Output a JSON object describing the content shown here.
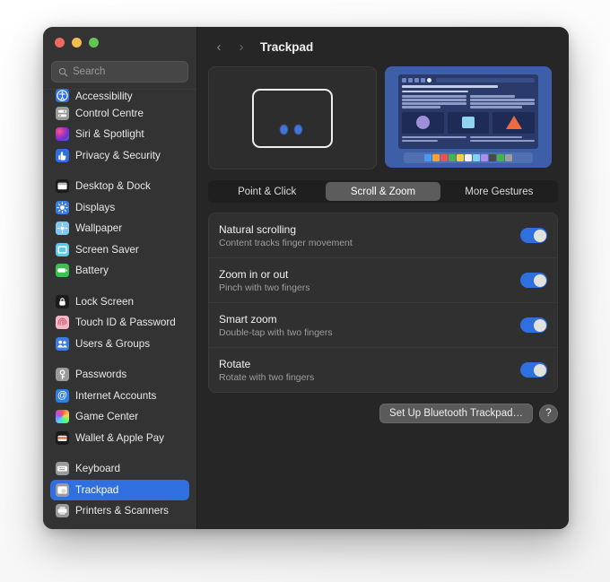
{
  "window": {
    "traffic_lights": [
      "close",
      "minimize",
      "zoom"
    ]
  },
  "sidebar": {
    "search": {
      "placeholder": "Search",
      "value": ""
    },
    "groups": [
      {
        "items": [
          {
            "label": "Accessibility",
            "icon": "accessibility-icon",
            "clipped": true
          },
          {
            "label": "Control Centre",
            "icon": "control-centre-icon"
          },
          {
            "label": "Siri & Spotlight",
            "icon": "siri-icon"
          },
          {
            "label": "Privacy & Security",
            "icon": "privacy-icon"
          }
        ]
      },
      {
        "items": [
          {
            "label": "Desktop & Dock",
            "icon": "desktop-dock-icon"
          },
          {
            "label": "Displays",
            "icon": "displays-icon"
          },
          {
            "label": "Wallpaper",
            "icon": "wallpaper-icon"
          },
          {
            "label": "Screen Saver",
            "icon": "screen-saver-icon"
          },
          {
            "label": "Battery",
            "icon": "battery-icon"
          }
        ]
      },
      {
        "items": [
          {
            "label": "Lock Screen",
            "icon": "lock-screen-icon"
          },
          {
            "label": "Touch ID & Password",
            "icon": "touch-id-icon"
          },
          {
            "label": "Users & Groups",
            "icon": "users-groups-icon"
          }
        ]
      },
      {
        "items": [
          {
            "label": "Passwords",
            "icon": "passwords-icon"
          },
          {
            "label": "Internet Accounts",
            "icon": "internet-accounts-icon"
          },
          {
            "label": "Game Center",
            "icon": "game-center-icon"
          },
          {
            "label": "Wallet & Apple Pay",
            "icon": "wallet-icon"
          }
        ]
      },
      {
        "items": [
          {
            "label": "Keyboard",
            "icon": "keyboard-icon"
          },
          {
            "label": "Trackpad",
            "icon": "trackpad-icon",
            "selected": true
          },
          {
            "label": "Printers & Scanners",
            "icon": "printers-icon"
          }
        ]
      }
    ]
  },
  "header": {
    "back_icon": "chevron-left-icon",
    "forward_icon": "chevron-right-icon",
    "title": "Trackpad"
  },
  "preview": {
    "left": {
      "name": "trackpad-gesture-preview",
      "fingers": 2
    },
    "right": {
      "name": "scroll-zoom-animation-preview"
    }
  },
  "tabs": [
    {
      "label": "Point & Click",
      "active": false
    },
    {
      "label": "Scroll & Zoom",
      "active": true
    },
    {
      "label": "More Gestures",
      "active": false
    }
  ],
  "settings": [
    {
      "title": "Natural scrolling",
      "subtitle": "Content tracks finger movement",
      "enabled": true
    },
    {
      "title": "Zoom in or out",
      "subtitle": "Pinch with two fingers",
      "enabled": true
    },
    {
      "title": "Smart zoom",
      "subtitle": "Double-tap with two fingers",
      "enabled": true
    },
    {
      "title": "Rotate",
      "subtitle": "Rotate with two fingers",
      "enabled": true
    }
  ],
  "footer": {
    "setup_button": "Set Up Bluetooth Trackpad…",
    "help_button": "?"
  },
  "colors": {
    "accent": "#2f6fe0",
    "window_bg": "#2b2b2b",
    "sidebar_bg": "#333333",
    "main_bg": "#262626"
  },
  "dock_icons": [
    "#4a9bf5",
    "#f2a33c",
    "#ef5350",
    "#4caf50",
    "#f5d23c",
    "#f2f2f2",
    "#7fd3f5",
    "#a98ef0",
    "#4a4a4a",
    "#43b64a",
    "#9e9e9e"
  ]
}
